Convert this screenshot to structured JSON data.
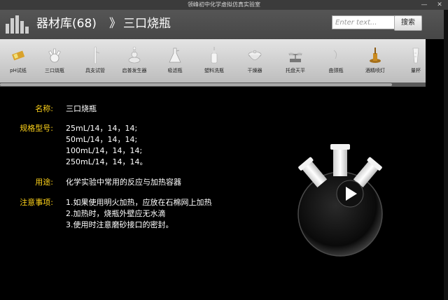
{
  "window": {
    "title": "领峰初中化学虚拟仿真实验室",
    "minimize_glyph": "—",
    "close_glyph": "✕"
  },
  "header": {
    "library_title": "器材库(68)",
    "separator": "》",
    "current": "三口烧瓶",
    "search_placeholder": "Enter text...",
    "search_button": "搜索"
  },
  "toolbar": {
    "items": [
      {
        "label": "pH试纸",
        "icon": "ph-paper-icon"
      },
      {
        "label": "三口烧瓶",
        "icon": "three-neck-flask-icon"
      },
      {
        "label": "具支试管",
        "icon": "branch-test-tube-icon"
      },
      {
        "label": "启普发生器",
        "icon": "kipp-generator-icon"
      },
      {
        "label": "吸滤瓶",
        "icon": "suction-flask-icon"
      },
      {
        "label": "塑料洗瓶",
        "icon": "wash-bottle-icon"
      },
      {
        "label": "干燥器",
        "icon": "desiccator-icon"
      },
      {
        "label": "托盘天平",
        "icon": "balance-icon"
      },
      {
        "label": "曲颈瓶",
        "icon": "retort-icon"
      },
      {
        "label": "酒精喷灯",
        "icon": "alcohol-blowtorch-icon"
      },
      {
        "label": "量杯",
        "icon": "measuring-cup-icon"
      }
    ]
  },
  "detail": {
    "name_label": "名称:",
    "name_value": "三口烧瓶",
    "spec_label": "规格型号:",
    "spec_values": [
      "25mL/14，14，14;",
      "50mL/14，14，14;",
      "100mL/14，14，14;",
      "250mL/14，14，14。"
    ],
    "use_label": "用途:",
    "use_value": "化学实验中常用的反应与加热容器",
    "notes_label": "注意事项:",
    "notes": [
      "1.如果使用明火加热，应放在石棉网上加热",
      "2.加热时，烧瓶外壁应无水滴",
      "3.使用时注意磨砂接口的密封。"
    ]
  },
  "colors": {
    "label": "#ffd31a",
    "value": "#ffffff",
    "background": "#000000",
    "header": "#4d4d4d"
  }
}
